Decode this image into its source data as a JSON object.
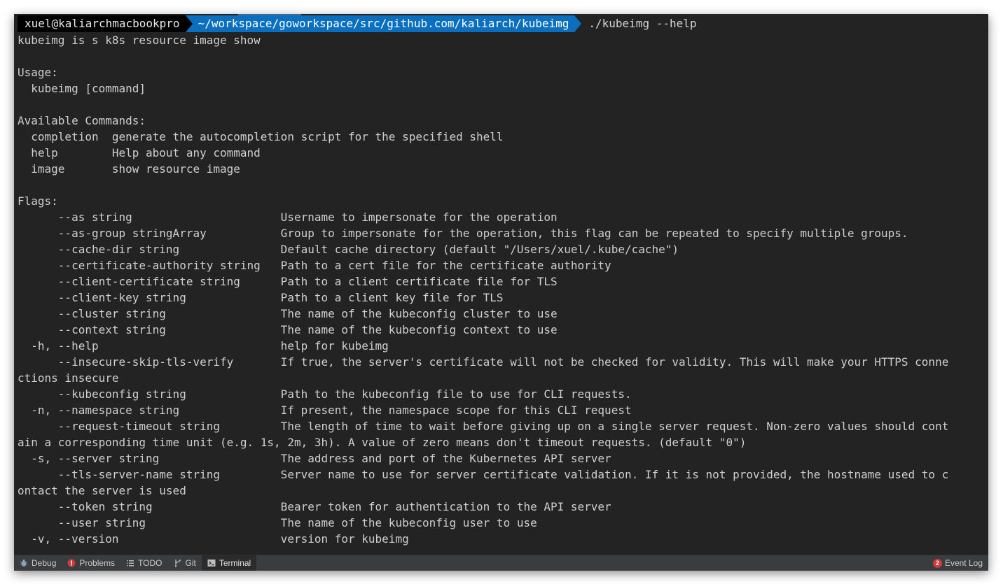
{
  "terminal": {
    "prompt_user": "xuel@kaliarchmacbookpro",
    "prompt_path": "~/workspace/goworkspace/src/github.com/kaliarch/kubeimg",
    "command": "./kubeimg --help",
    "output_lines": [
      "kubeimg is s k8s resource image show",
      "",
      "Usage:",
      "  kubeimg [command]",
      "",
      "Available Commands:",
      "  completion  generate the autocompletion script for the specified shell",
      "  help        Help about any command",
      "  image       show resource image",
      "",
      "Flags:",
      "      --as string                      Username to impersonate for the operation",
      "      --as-group stringArray           Group to impersonate for the operation, this flag can be repeated to specify multiple groups.",
      "      --cache-dir string               Default cache directory (default \"/Users/xuel/.kube/cache\")",
      "      --certificate-authority string   Path to a cert file for the certificate authority",
      "      --client-certificate string      Path to a client certificate file for TLS",
      "      --client-key string              Path to a client key file for TLS",
      "      --cluster string                 The name of the kubeconfig cluster to use",
      "      --context string                 The name of the kubeconfig context to use",
      "  -h, --help                           help for kubeimg",
      "      --insecure-skip-tls-verify       If true, the server's certificate will not be checked for validity. This will make your HTTPS conne",
      "ctions insecure",
      "      --kubeconfig string              Path to the kubeconfig file to use for CLI requests.",
      "  -n, --namespace string               If present, the namespace scope for this CLI request",
      "      --request-timeout string         The length of time to wait before giving up on a single server request. Non-zero values should cont",
      "ain a corresponding time unit (e.g. 1s, 2m, 3h). A value of zero means don't timeout requests. (default \"0\")",
      "  -s, --server string                  The address and port of the Kubernetes API server",
      "      --tls-server-name string         Server name to use for server certificate validation. If it is not provided, the hostname used to c",
      "ontact the server is used",
      "      --token string                   Bearer token for authentication to the API server",
      "      --user string                    The name of the kubeconfig user to use",
      "  -v, --version                        version for kubeimg"
    ]
  },
  "statusbar": {
    "tabs": [
      {
        "label": "Debug",
        "icon": "bug-icon"
      },
      {
        "label": "Problems",
        "icon": "error-icon"
      },
      {
        "label": "TODO",
        "icon": "list-icon"
      },
      {
        "label": "Git",
        "icon": "branch-icon"
      },
      {
        "label": "Terminal",
        "icon": "terminal-icon"
      }
    ],
    "event_log_label": "Event Log",
    "event_log_count": "2"
  },
  "colors": {
    "terminal_bg": "#232323",
    "prompt_path_bg": "#0a6fbf",
    "badge": "#d23a3a"
  }
}
